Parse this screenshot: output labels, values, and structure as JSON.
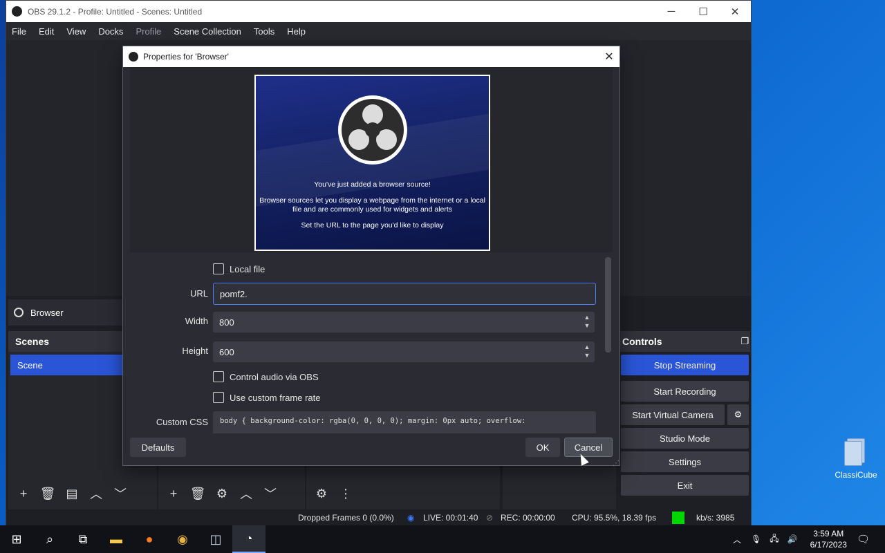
{
  "window": {
    "title": "OBS 29.1.2 - Profile: Untitled - Scenes: Untitled",
    "controls": [
      "─",
      "☐",
      "✕"
    ]
  },
  "menu": [
    "File",
    "Edit",
    "View",
    "Docks",
    "Profile",
    "Scene Collection",
    "Tools",
    "Help"
  ],
  "sources": {
    "current": "Browser"
  },
  "scenes": {
    "title": "Scenes",
    "items": [
      "Scene"
    ]
  },
  "controls": {
    "title": "Controls",
    "stop_streaming": "Stop Streaming",
    "start_recording": "Start Recording",
    "start_virtual_camera": "Start Virtual Camera",
    "studio_mode": "Studio Mode",
    "settings": "Settings",
    "exit": "Exit"
  },
  "status": {
    "dropped": "Dropped Frames 0 (0.0%)",
    "live": "LIVE: 00:01:40",
    "rec": "REC: 00:00:00",
    "cpu": "CPU: 95.5%, 18.39 fps",
    "kbs": "kb/s: 3985",
    "indicator_color": "#00d600"
  },
  "dialog": {
    "title": "Properties for 'Browser'",
    "preview": {
      "line1": "You've just added a browser source!",
      "line2a": "Browser sources let you display a webpage from the internet or a local",
      "line2b": "file and are commonly used for widgets and alerts",
      "line3": "Set the URL to the page you'd like to display"
    },
    "local_file": "Local file",
    "url_label": "URL",
    "url_value": "pomf2.",
    "width_label": "Width",
    "width_value": "800",
    "height_label": "Height",
    "height_value": "600",
    "control_audio": "Control audio via OBS",
    "custom_frame_rate": "Use custom frame rate",
    "css_label": "Custom CSS",
    "css_value": "body { background-color: rgba(0, 0, 0, 0); margin: 0px auto; overflow:",
    "defaults": "Defaults",
    "ok": "OK",
    "cancel": "Cancel"
  },
  "desktop": {
    "icon_label": "ClassiCube"
  },
  "taskbar": {
    "time": "3:59 AM",
    "date": "6/17/2023"
  }
}
